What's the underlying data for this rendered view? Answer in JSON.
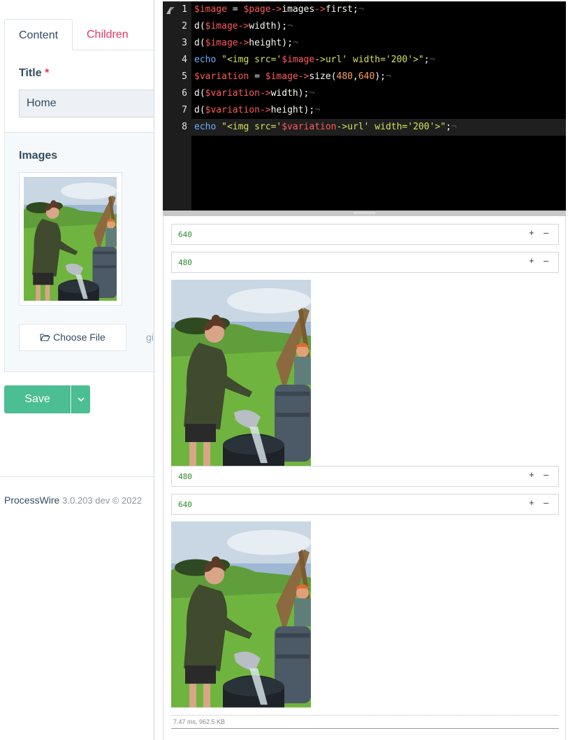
{
  "admin": {
    "tabs": [
      {
        "label": "Content",
        "active": true
      },
      {
        "label": "Children",
        "active": false
      }
    ],
    "title_field": {
      "label": "Title",
      "required_mark": "*",
      "value": "Home"
    },
    "images_field": {
      "label": "Images",
      "choose_file_label": "Choose File",
      "cut_off_text": "gi"
    },
    "save_button": {
      "label": "Save"
    },
    "footer": {
      "brand": "ProcessWire",
      "version": "3.0.203 dev © 2022"
    }
  },
  "editor": {
    "line_numbers": [
      "1",
      "2",
      "3",
      "4",
      "5",
      "6",
      "7",
      "8"
    ],
    "lines": [
      "$image = $page->images->first;",
      "d($image->width);",
      "d($image->height);",
      "echo \"<img src='$image->url' width='200'>\";",
      "$variation = $image->size(480,640);",
      "d($variation->width);",
      "d($variation->height);",
      "echo \"<img src='$variation->url' width='200'>\";"
    ],
    "active_line": 8
  },
  "output": {
    "dumps": [
      {
        "value": "640",
        "expand": "+",
        "collapse": "–"
      },
      {
        "value": "480",
        "expand": "+",
        "collapse": "–"
      },
      {
        "value": "480",
        "expand": "+",
        "collapse": "–"
      },
      {
        "value": "640",
        "expand": "+",
        "collapse": "–"
      }
    ],
    "stats": "7.47 ms, 962.5 KB"
  },
  "colors": {
    "accent_green": "#4cbe93",
    "tab_inactive": "#e83561",
    "editor_bg": "#000000",
    "dump_value": "#2e8b2e"
  }
}
